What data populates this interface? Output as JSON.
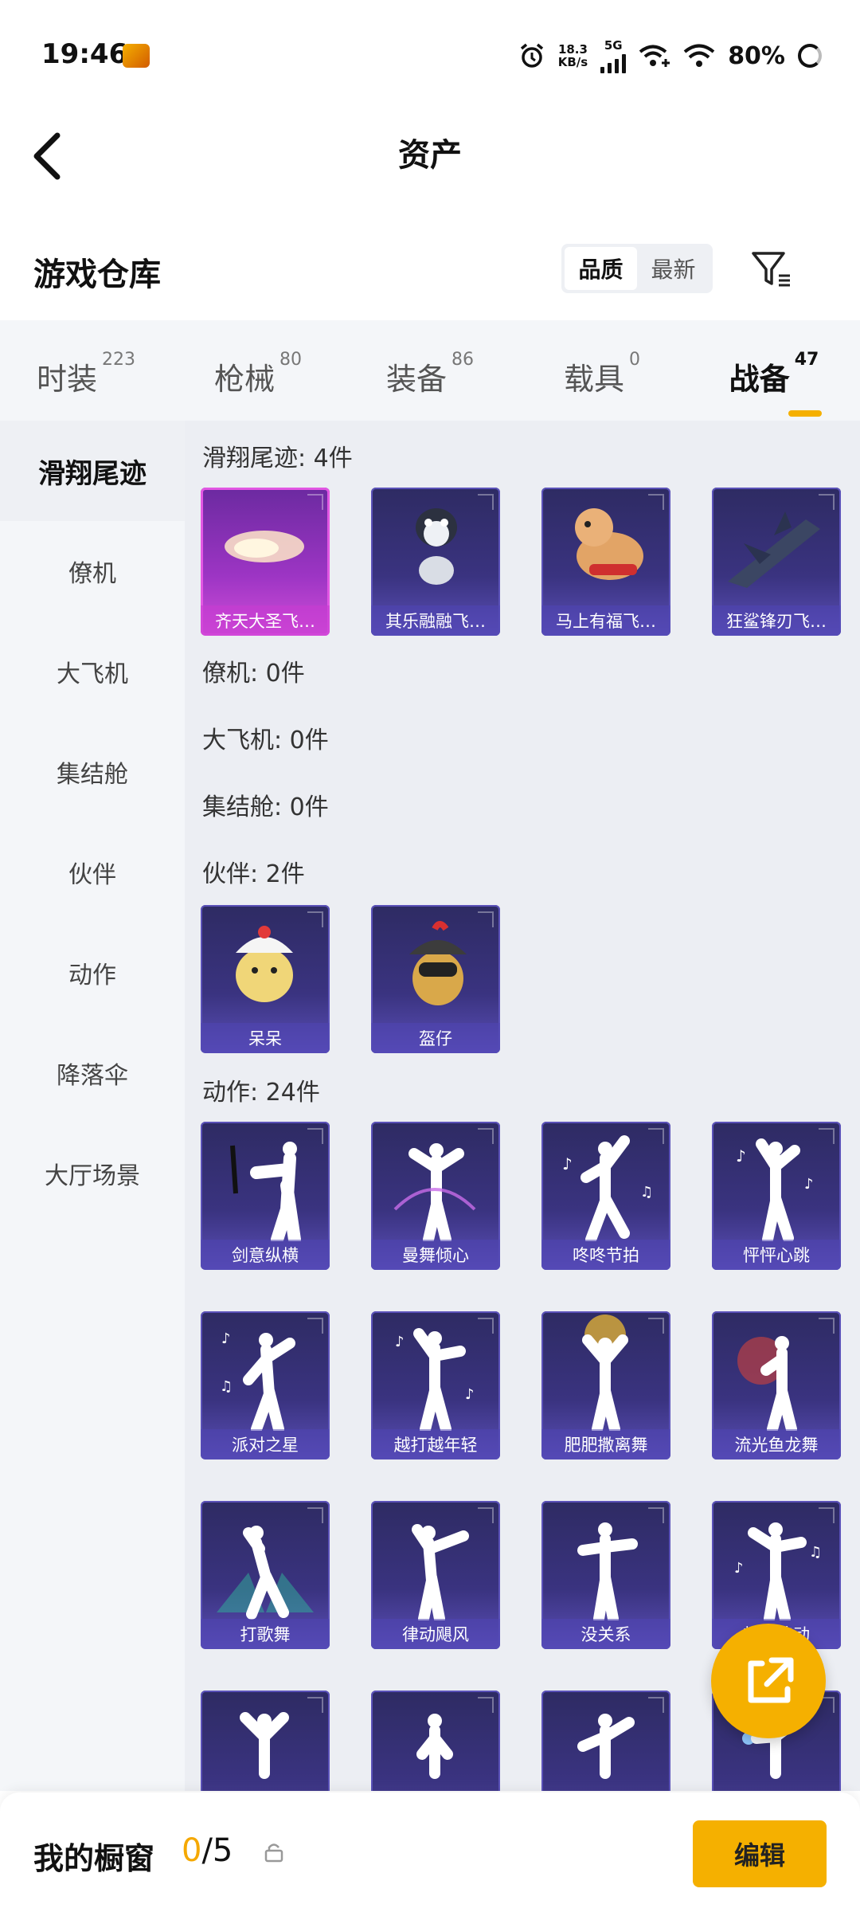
{
  "status_bar": {
    "time": "19:46",
    "speed_value": "18.3",
    "speed_unit": "KB/s",
    "network": "5G",
    "battery": "80%"
  },
  "header": {
    "title": "资产"
  },
  "warehouse": {
    "title": "游戏仓库",
    "sort_options": [
      "品质",
      "最新"
    ],
    "sort_selected": "品质"
  },
  "category_tabs": [
    {
      "label": "时装",
      "count": "223"
    },
    {
      "label": "枪械",
      "count": "80"
    },
    {
      "label": "装备",
      "count": "86"
    },
    {
      "label": "载具",
      "count": "0"
    },
    {
      "label": "战备",
      "count": "47",
      "active": true
    }
  ],
  "sidebar": [
    {
      "label": "滑翔尾迹",
      "active": true
    },
    {
      "label": "僚机"
    },
    {
      "label": "大飞机"
    },
    {
      "label": "集结舱"
    },
    {
      "label": "伙伴"
    },
    {
      "label": "动作"
    },
    {
      "label": "降落伞"
    },
    {
      "label": "大厅场景"
    }
  ],
  "sections": {
    "glide": {
      "label": "滑翔尾迹: 4件",
      "items": [
        "齐天大圣飞…",
        "其乐融融飞…",
        "马上有福飞…",
        "狂鲨锋刃飞…"
      ]
    },
    "wingman": {
      "label": "僚机: 0件"
    },
    "plane": {
      "label": "大飞机: 0件"
    },
    "pod": {
      "label": "集结舱: 0件"
    },
    "partner": {
      "label": "伙伴: 2件",
      "items": [
        "呆呆",
        "盔仔"
      ]
    },
    "emote": {
      "label": "动作: 24件",
      "items": [
        "剑意纵横",
        "曼舞倾心",
        "咚咚节拍",
        "怦怦心跳",
        "派对之星",
        "越打越年轻",
        "肥肥撒离舞",
        "流光鱼龙舞",
        "打歌舞",
        "律动飓风",
        "没关系",
        "热潮律动"
      ]
    }
  },
  "bottom_bar": {
    "label": "我的橱窗",
    "current": "0",
    "total": "/5",
    "edit_label": "编辑"
  }
}
